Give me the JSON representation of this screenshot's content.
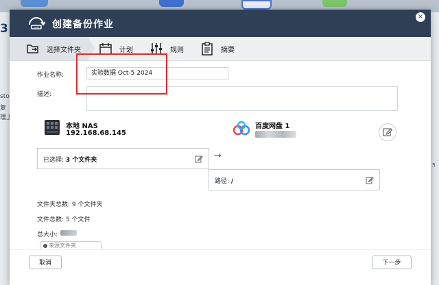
{
  "dialog": {
    "title": "创建备份作业",
    "close_glyph": "×"
  },
  "steps": [
    {
      "label": "选择文件夹",
      "icon": "folder-transfer-icon",
      "active": true
    },
    {
      "label": "计划",
      "icon": "calendar-icon",
      "active": false
    },
    {
      "label": "规则",
      "icon": "sliders-icon",
      "active": false
    },
    {
      "label": "摘要",
      "icon": "clipboard-icon",
      "active": false
    }
  ],
  "form": {
    "job_name_label": "作业名称:",
    "job_name_value": "实验数据 Oct-5 2024",
    "description_label": "描述:",
    "description_value": ""
  },
  "source": {
    "name": "本地 NAS",
    "ip": "192.168.68.145",
    "icon": "nas-icon"
  },
  "destination": {
    "name": "百度网盘 1",
    "icon": "baidu-cloud-icon"
  },
  "selection": {
    "label": "已选择:",
    "value": "3 个文件夹"
  },
  "path": {
    "label": "路径:",
    "value": "/"
  },
  "arrow_glyph": "→",
  "stats": {
    "folders_label": "文件夹总数:",
    "folders_value": "9 个文件夹",
    "files_label": "文件总数:",
    "files_value": "5 个文件",
    "size_label": "总大小:"
  },
  "partial_button_text": "来源文件夹",
  "buttons": {
    "cancel": "取消",
    "next": "下一步"
  },
  "background": {
    "left_number": "3",
    "left_texts": [
      "sto",
      "复",
      "理上"
    ],
    "right_text": "s"
  },
  "colors": {
    "titlebar": "#2f3f56",
    "highlight_box": "#e02a2a"
  }
}
